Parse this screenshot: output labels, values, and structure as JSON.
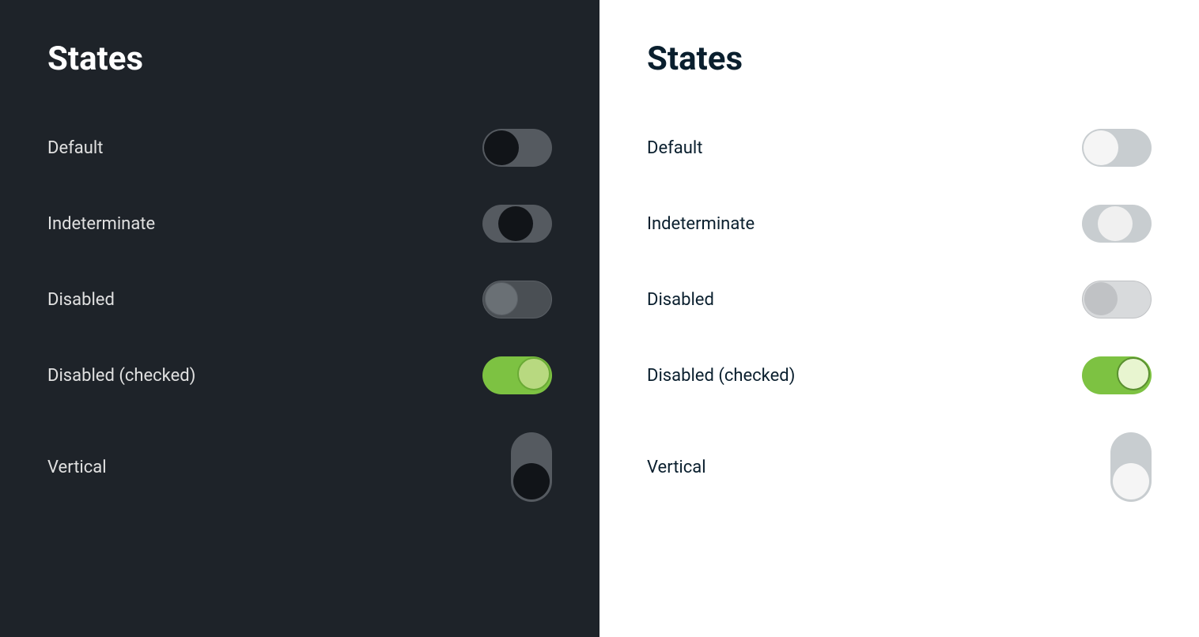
{
  "dark_panel": {
    "title": "States",
    "states": [
      {
        "id": "default",
        "label": "Default"
      },
      {
        "id": "indeterminate",
        "label": "Indeterminate"
      },
      {
        "id": "disabled",
        "label": "Disabled"
      },
      {
        "id": "disabled-checked",
        "label": "Disabled (checked)"
      },
      {
        "id": "vertical",
        "label": "Vertical"
      }
    ]
  },
  "light_panel": {
    "title": "States",
    "states": [
      {
        "id": "default",
        "label": "Default"
      },
      {
        "id": "indeterminate",
        "label": "Indeterminate"
      },
      {
        "id": "disabled",
        "label": "Disabled"
      },
      {
        "id": "disabled-checked",
        "label": "Disabled (checked)"
      },
      {
        "id": "vertical",
        "label": "Vertical"
      }
    ]
  }
}
